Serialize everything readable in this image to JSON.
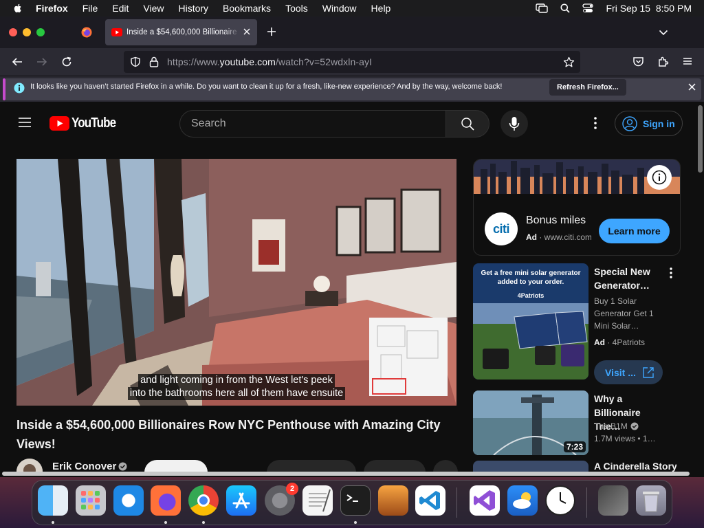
{
  "menubar": {
    "app": "Firefox",
    "items": [
      "File",
      "Edit",
      "View",
      "History",
      "Bookmarks",
      "Tools",
      "Window",
      "Help"
    ],
    "clock": "Fri Sep 15  8:50 PM"
  },
  "browser": {
    "tab_title": "Inside a $54,600,000 Billionaire",
    "url_prefix": "https://www.",
    "url_host": "youtube.com",
    "url_path": "/watch?v=52wdxln-ayI",
    "notification_text": "It looks like you haven’t started Firefox in a while. Do you want to clean it up for a fresh, like-new experience? And by the way, welcome back!",
    "notification_button": "Refresh Firefox..."
  },
  "youtube": {
    "logo_text": "YouTube",
    "search_placeholder": "Search",
    "signin_label": "Sign in",
    "caption_line1": "and light coming in from the West let's peek",
    "caption_line2": "into the bathrooms here all of them have ensuite",
    "video_title": "Inside a $54,600,000 Billionaires Row NYC Penthouse with Amazing City Views!",
    "channel_name": "Erik Conover"
  },
  "sidebar": {
    "ad1": {
      "logo": "citi",
      "title": "Bonus miles",
      "ad_label": "Ad",
      "domain": "www.citi.com",
      "cta": "Learn more"
    },
    "ad2": {
      "thumb_line1": "Get a free mini solar generator",
      "thumb_line2": "added to your order.",
      "thumb_brand": "4Patriots",
      "title": "Special New Generator…",
      "desc": "Buy 1 Solar Generator Get 1 Mini Solar…",
      "ad_label": "Ad",
      "advertiser": "4Patriots",
      "cta": "Visit ..."
    },
    "rec1": {
      "title": "Why a Billionaire Trie…",
      "channel": "The B1M",
      "views": "1.7M views",
      "age": "1…",
      "duration": "7:23"
    },
    "rec2": {
      "title": "A Cinderella Story:"
    }
  },
  "dock": {
    "settings_badge": "2"
  },
  "colors": {
    "youtube_red": "#ff0000",
    "link_blue": "#3ea6ff",
    "page_bg": "#0f0f0f",
    "notification_accent": "#c54acc"
  }
}
